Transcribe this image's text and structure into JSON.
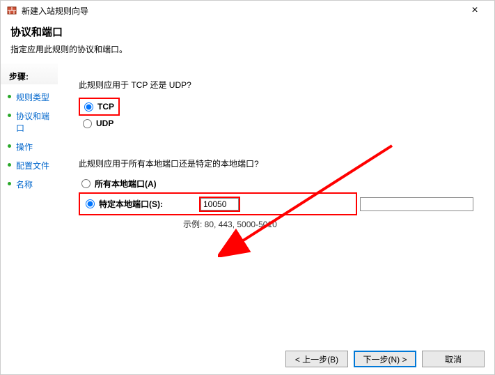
{
  "window": {
    "title": "新建入站规则向导",
    "close": "×"
  },
  "header": {
    "title": "协议和端口",
    "subtitle": "指定应用此规则的协议和端口。"
  },
  "sidebar": {
    "stepsLabel": "步骤:",
    "items": [
      {
        "label": "规则类型"
      },
      {
        "label": "协议和端口"
      },
      {
        "label": "操作"
      },
      {
        "label": "配置文件"
      },
      {
        "label": "名称"
      }
    ]
  },
  "content": {
    "q1": "此规则应用于 TCP 还是 UDP?",
    "tcp": "TCP",
    "udp": "UDP",
    "q2": "此规则应用于所有本地端口还是特定的本地端口?",
    "allPorts": "所有本地端口(A)",
    "specificPorts": "特定本地端口(S):",
    "portValue": "10050",
    "exampleLabel": "示例: 80, 443, 5000-5010"
  },
  "footer": {
    "back": "< 上一步(B)",
    "next": "下一步(N) >",
    "cancel": "取消"
  }
}
